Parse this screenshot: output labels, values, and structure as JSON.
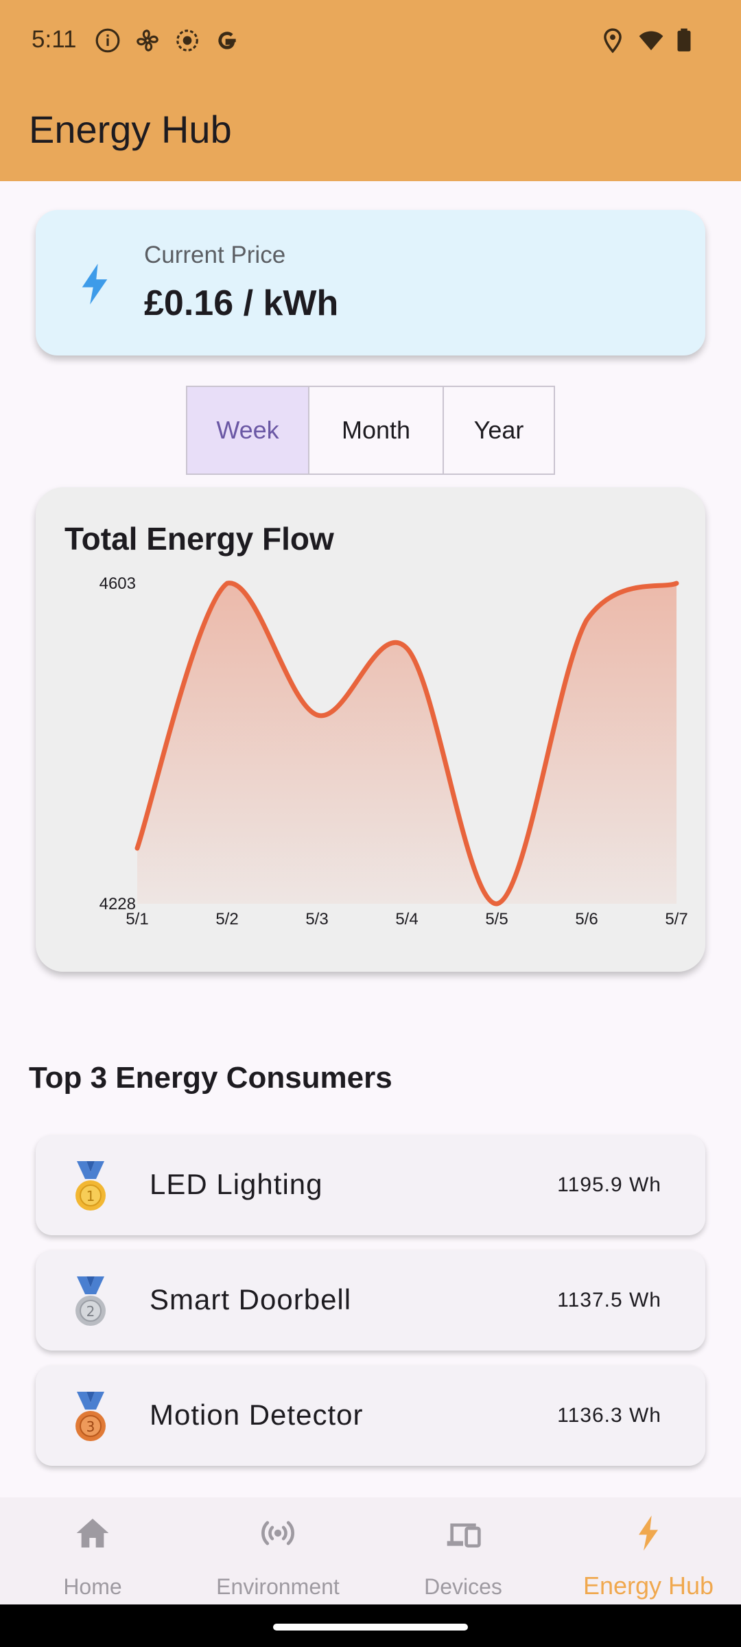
{
  "status_bar": {
    "time": "5:11",
    "left_icons": [
      "info-icon",
      "fan-icon",
      "record-icon",
      "google-icon"
    ],
    "right_icons": [
      "location-icon",
      "wifi-icon",
      "battery-icon"
    ]
  },
  "app_bar": {
    "title": "Energy Hub",
    "color": "#E9A85A"
  },
  "price_card": {
    "icon": "bolt-icon",
    "label": "Current Price",
    "value": "£0.16 / kWh",
    "background": "#E1F3FC",
    "icon_color": "#3D9BE9"
  },
  "period_selector": {
    "options": [
      "Week",
      "Month",
      "Year"
    ],
    "selected": "Week"
  },
  "chart_card": {
    "title": "Total Energy Flow"
  },
  "chart_data": {
    "type": "area",
    "title": "Total Energy Flow",
    "categories": [
      "5/1",
      "5/2",
      "5/3",
      "5/4",
      "5/5",
      "5/6",
      "5/7"
    ],
    "series": [
      {
        "values": [
          4293,
          4603,
          4449,
          4527,
          4228,
          4560,
          4603
        ]
      }
    ],
    "ylim": [
      4228,
      4603
    ],
    "y_tick_labels": [
      "4603",
      "4228"
    ],
    "line_color": "#E8643C",
    "smooth": true,
    "grid": false
  },
  "consumers": {
    "title": "Top 3 Energy Consumers",
    "items": [
      {
        "rank": 1,
        "icon": "gold-medal-icon",
        "name": "LED Lighting",
        "value": "1195.9 Wh"
      },
      {
        "rank": 2,
        "icon": "silver-medal-icon",
        "name": "Smart Doorbell",
        "value": "1137.5 Wh"
      },
      {
        "rank": 3,
        "icon": "bronze-medal-icon",
        "name": "Motion Detector",
        "value": "1136.3 Wh"
      }
    ]
  },
  "bottom_nav": {
    "items": [
      {
        "label": "Home",
        "icon": "home-icon"
      },
      {
        "label": "Environment",
        "icon": "sensors-icon"
      },
      {
        "label": "Devices",
        "icon": "devices-icon"
      },
      {
        "label": "Energy Hub",
        "icon": "bolt-icon"
      }
    ],
    "active": "Energy Hub",
    "active_color": "#F0A84E"
  }
}
